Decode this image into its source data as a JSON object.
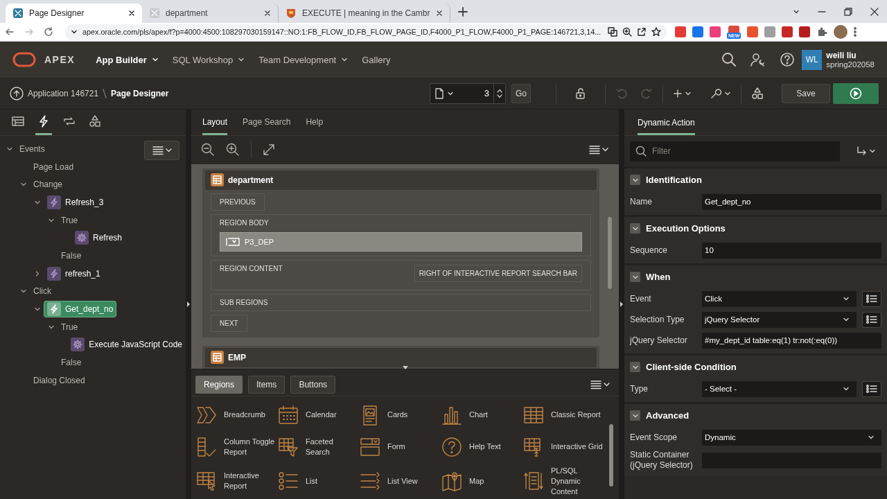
{
  "browser": {
    "tabs": [
      {
        "title": "Page Designer",
        "kind": "apex",
        "selected": true
      },
      {
        "title": "department",
        "kind": "blank",
        "selected": false
      },
      {
        "title": "EXECUTE | meaning in the Cambr",
        "kind": "dictionary",
        "selected": false
      }
    ],
    "url": "apex.oracle.com/pls/apex/f?p=4000:4500:108297030159147::NO:1:FB_FLOW_ID,FB_FLOW_PAGE_ID,F4000_P1_FLOW,F4000_P1_PAGE:146721,3,14...",
    "extension_badge": "NEW"
  },
  "header": {
    "logo": "APEX",
    "nav": [
      {
        "label": "App Builder",
        "selected": true,
        "menu": true
      },
      {
        "label": "SQL Workshop",
        "selected": false,
        "menu": true
      },
      {
        "label": "Team Development",
        "selected": false,
        "menu": true
      },
      {
        "label": "Gallery",
        "selected": false,
        "menu": false
      }
    ],
    "user": {
      "initials": "WL",
      "name": "weili liu",
      "workspace": "spring202058"
    }
  },
  "toolbar": {
    "breadcrumb": [
      "Application 146721",
      "Page Designer"
    ],
    "page_number": "3",
    "go": "Go",
    "undo": {
      "disabled": true
    },
    "redo": {
      "disabled": true
    },
    "save": "Save"
  },
  "left_panel": {
    "tabs": [
      {
        "kind": "rendering",
        "selected": false
      },
      {
        "kind": "dynamic_actions",
        "selected": true
      },
      {
        "kind": "processing",
        "selected": false
      },
      {
        "kind": "shared",
        "selected": false
      }
    ],
    "tree": [
      {
        "label": "Events",
        "kind": "folder",
        "expanded": true,
        "children": [
          {
            "label": "Page Load",
            "kind": "folder"
          },
          {
            "label": "Change",
            "kind": "folder",
            "expanded": true,
            "children": [
              {
                "label": "Refresh_3",
                "kind": "action",
                "selected": false,
                "expanded": true,
                "children": [
                  {
                    "label": "True",
                    "kind": "folder",
                    "expanded": true,
                    "children": [
                      {
                        "label": "Refresh",
                        "kind": "step",
                        "selected": false
                      }
                    ]
                  },
                  {
                    "label": "False",
                    "kind": "folder"
                  }
                ]
              },
              {
                "label": "refresh_1",
                "kind": "action",
                "selected": false,
                "expanded": false
              }
            ]
          },
          {
            "label": "Click",
            "kind": "folder",
            "expanded": true,
            "children": [
              {
                "label": "Get_dept_no",
                "kind": "action",
                "selected": true,
                "expanded": true,
                "children": [
                  {
                    "label": "True",
                    "kind": "folder",
                    "expanded": true,
                    "children": [
                      {
                        "label": "Execute JavaScript Code",
                        "kind": "step",
                        "selected": false
                      }
                    ]
                  },
                  {
                    "label": "False",
                    "kind": "folder"
                  }
                ]
              }
            ]
          },
          {
            "label": "Dialog Closed",
            "kind": "folder"
          }
        ]
      }
    ]
  },
  "center": {
    "tabs": [
      {
        "label": "Layout",
        "selected": true
      },
      {
        "label": "Page Search",
        "selected": false
      },
      {
        "label": "Help",
        "selected": false
      }
    ],
    "regions": [
      {
        "title": "department",
        "slots": [
          {
            "label": "PREVIOUS",
            "kind": "compact"
          },
          {
            "label": "REGION BODY",
            "kind": "full",
            "items": [
              "P3_DEP"
            ]
          },
          {
            "label": "REGION CONTENT",
            "kind": "full",
            "side_slot": "RIGHT OF INTERACTIVE REPORT SEARCH BAR"
          },
          {
            "label": "SUB REGIONS",
            "kind": "full"
          },
          {
            "label": "NEXT",
            "kind": "compact"
          }
        ]
      },
      {
        "title": "EMP"
      }
    ],
    "gallery": {
      "tabs": [
        {
          "label": "Regions",
          "selected": true
        },
        {
          "label": "Items",
          "selected": false
        },
        {
          "label": "Buttons",
          "selected": false
        }
      ],
      "items": [
        {
          "label": "Breadcrumb",
          "kind": "breadcrumb"
        },
        {
          "label": "Calendar",
          "kind": "calendar"
        },
        {
          "label": "Cards",
          "kind": "cards"
        },
        {
          "label": "Chart",
          "kind": "chart"
        },
        {
          "label": "Classic Report",
          "kind": "classic_report"
        },
        {
          "label": "Column Toggle Report",
          "kind": "column_toggle"
        },
        {
          "label": "Faceted Search",
          "kind": "faceted_search"
        },
        {
          "label": "Form",
          "kind": "form"
        },
        {
          "label": "Help Text",
          "kind": "help_text"
        },
        {
          "label": "Interactive Grid",
          "kind": "interactive_grid"
        },
        {
          "label": "Interactive Report",
          "kind": "interactive_report"
        },
        {
          "label": "List",
          "kind": "list"
        },
        {
          "label": "List View",
          "kind": "list_view"
        },
        {
          "label": "Map",
          "kind": "map"
        },
        {
          "label": "PL/SQL Dynamic Content",
          "kind": "plsql"
        }
      ]
    }
  },
  "right_panel": {
    "tabs": [
      {
        "label": "Dynamic Action",
        "selected": true
      }
    ],
    "filter": {
      "placeholder": "Filter"
    },
    "sections": [
      {
        "title": "Identification",
        "expanded": true,
        "rows": [
          {
            "label": "Name",
            "kind": "text",
            "value": "Get_dept_no"
          }
        ]
      },
      {
        "title": "Execution Options",
        "expanded": true,
        "rows": [
          {
            "label": "Sequence",
            "kind": "text",
            "value": "10"
          }
        ]
      },
      {
        "title": "When",
        "expanded": true,
        "rows": [
          {
            "label": "Event",
            "kind": "select_lov",
            "value": "Click"
          },
          {
            "label": "Selection Type",
            "kind": "select_lov",
            "value": "jQuery Selector"
          },
          {
            "label": "jQuery Selector",
            "kind": "text",
            "value": "#my_dept_id table:eq(1) tr:not(:eq(0))"
          }
        ]
      },
      {
        "title": "Client-side Condition",
        "expanded": true,
        "rows": [
          {
            "label": "Type",
            "kind": "select_lov",
            "value": "- Select -"
          }
        ]
      },
      {
        "title": "Advanced",
        "expanded": true,
        "rows": [
          {
            "label": "Event Scope",
            "kind": "select",
            "value": "Dynamic"
          },
          {
            "label": "Static Container (jQuery Selector)",
            "kind": "text"
          }
        ]
      }
    ]
  }
}
